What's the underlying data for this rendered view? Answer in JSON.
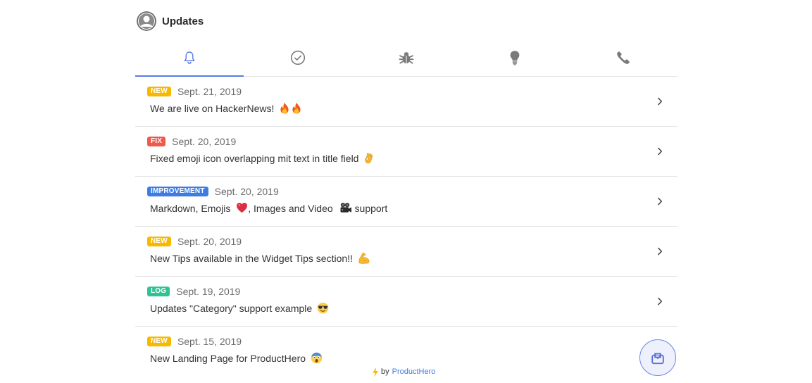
{
  "header": {
    "title": "Updates",
    "avatar_icon": "user-avatar-icon"
  },
  "tabs": [
    {
      "icon": "bell-icon",
      "active": true
    },
    {
      "icon": "check-circle-icon",
      "active": false
    },
    {
      "icon": "bug-icon",
      "active": false
    },
    {
      "icon": "lightbulb-icon",
      "active": false
    },
    {
      "icon": "phone-icon",
      "active": false
    }
  ],
  "updates": [
    {
      "badge": "NEW",
      "badge_type": "new",
      "date": "Sept. 21, 2019",
      "title": "We are live on HackerNews!",
      "emojis": [
        "fire",
        "fire"
      ]
    },
    {
      "badge": "FIX",
      "badge_type": "fix",
      "date": "Sept. 20, 2019",
      "title": "Fixed emoji icon overlapping mit text in title field",
      "emojis": [
        "ok-hand"
      ]
    },
    {
      "badge": "IMPROVEMENT",
      "badge_type": "improvement",
      "date": "Sept. 20, 2019",
      "title_parts": [
        "Markdown, Emojis",
        ", Images and Video",
        "support"
      ],
      "emojis": [
        "heart",
        "video-camera"
      ]
    },
    {
      "badge": "NEW",
      "badge_type": "new",
      "date": "Sept. 20, 2019",
      "title": "New Tips available in the Widget Tips section!!",
      "emojis": [
        "flexed-biceps"
      ]
    },
    {
      "badge": "LOG",
      "badge_type": "log",
      "date": "Sept. 19, 2019",
      "title": "Updates \"Category\" support example",
      "emojis": [
        "sunglasses"
      ]
    },
    {
      "badge": "NEW",
      "badge_type": "new",
      "date": "Sept. 15, 2019",
      "title": "New Landing Page for ProductHero",
      "emojis": [
        "screaming-face"
      ]
    }
  ],
  "footer": {
    "by": "by",
    "brand": "ProductHero"
  },
  "colors": {
    "accent": "#5b7be3",
    "new": "#f7b800",
    "fix": "#ef5a4c",
    "improvement": "#3d7de3",
    "log": "#2ec393"
  }
}
